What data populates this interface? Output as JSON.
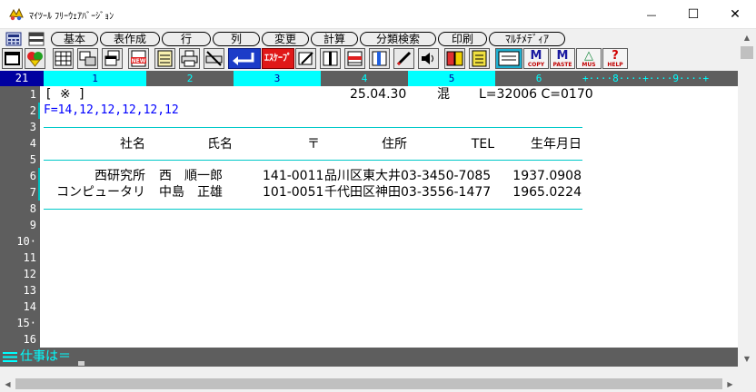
{
  "window": {
    "title": "ﾏｲﾂｰﾙ ﾌﾘｰｳｪｱﾊﾞｰｼﾞｮﾝ",
    "minimize_glyph": "—",
    "maximize_glyph": "☐",
    "close_glyph": "✕"
  },
  "menu": {
    "items": [
      "基本",
      "表作成",
      "行",
      "列",
      "変更",
      "計算",
      "分類検索",
      "印刷",
      "ﾏﾙﾁﾒﾃﾞｨｱ"
    ]
  },
  "toolbar": {
    "escape_label": "ｴｽｹｰﾌﾟ",
    "copy_btn": {
      "big": "M",
      "small": "COPY"
    },
    "paste_btn": {
      "big": "M",
      "small": "PASTE"
    },
    "mus_btn": {
      "big": "△",
      "small": "MUS"
    },
    "help_btn": {
      "big": "?",
      "small": "HELP"
    }
  },
  "ruler": {
    "current_column": "21",
    "columns": [
      "1",
      "2",
      "3",
      "4",
      "5",
      "6"
    ],
    "tail": "+····8····+····9····+",
    "colors": {
      "cyan": "#00ffff",
      "gray": "#5e5e5e",
      "navy": "#0000a0"
    }
  },
  "gutter": {
    "line_numbers": [
      "1",
      "2",
      "3",
      "4",
      "5",
      "6",
      "7",
      "8",
      "9",
      "10·",
      "11",
      "12",
      "13",
      "14",
      "15·",
      "16"
    ]
  },
  "editor": {
    "line1": {
      "bracket": "[ ※ ]",
      "date": "25.04.30",
      "mode": "混",
      "status": "L=32006 C=0170"
    },
    "line2": "F=14,12,12,12,12,12",
    "table": {
      "headers": [
        "社名",
        "氏名",
        "〒",
        "住所",
        "TEL",
        "生年月日"
      ],
      "rows": [
        [
          "西研究所",
          "西　順一郎",
          "141-0011",
          "品川区東大井",
          "03-3450-7085",
          "1937.0908"
        ],
        [
          "コンピュータリ",
          "中島　正雄",
          "101-0051",
          "千代田区神田",
          "03-3556-1477",
          "1965.0224"
        ]
      ]
    }
  },
  "command": {
    "label": "仕事は＝",
    "value": ""
  }
}
